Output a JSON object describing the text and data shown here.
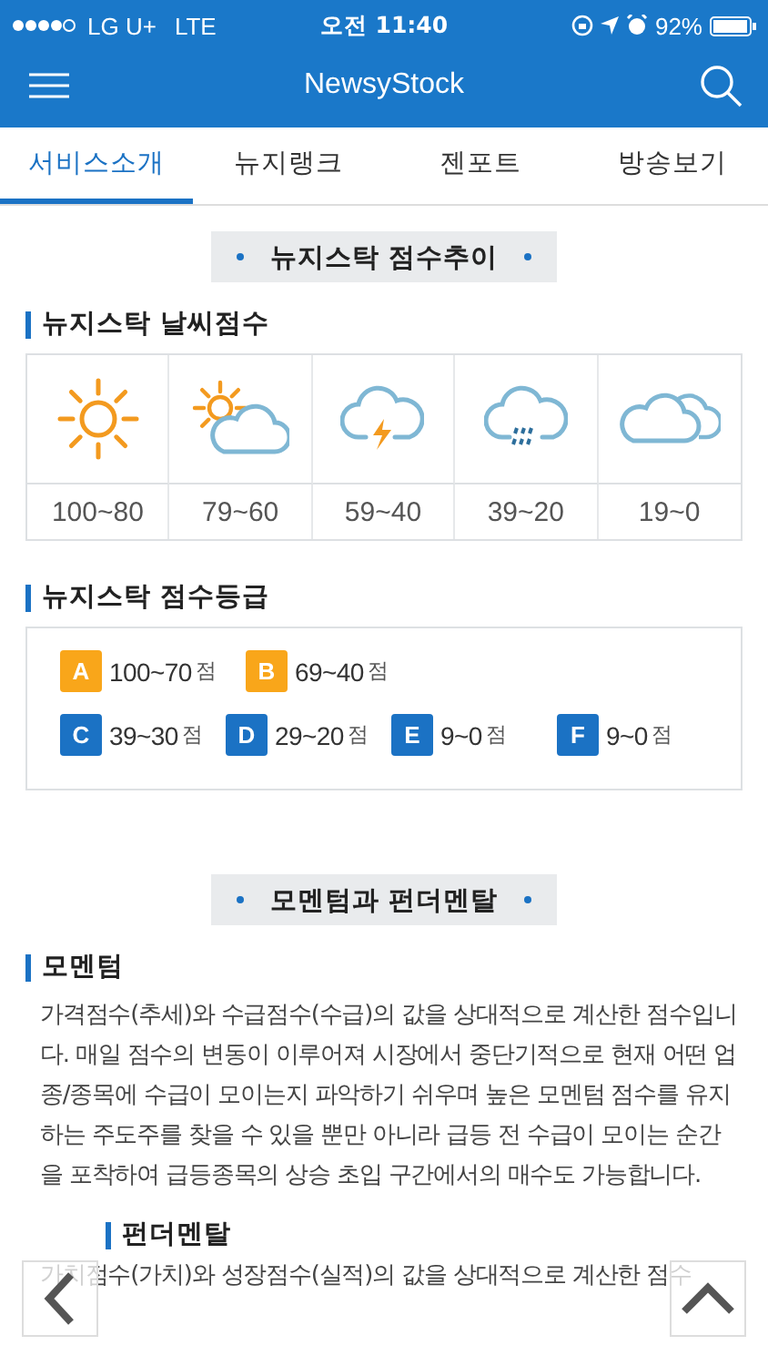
{
  "status_bar": {
    "carrier": "LG U+",
    "network": "LTE",
    "time": "오전 11:40",
    "battery": "92%"
  },
  "app_bar": {
    "title": "NewsyStock"
  },
  "tabs": [
    {
      "label": "서비스소개",
      "selected": true
    },
    {
      "label": "뉴지랭크",
      "selected": false
    },
    {
      "label": "젠포트",
      "selected": false
    },
    {
      "label": "방송보기",
      "selected": false
    }
  ],
  "sections": [
    {
      "title": "뉴지스탁 점수추이",
      "blocks": [
        {
          "kind": "weather",
          "heading": "뉴지스탁 날씨점수",
          "items": [
            {
              "kind": "sun",
              "range": "100~80"
            },
            {
              "kind": "partly",
              "range": "79~60"
            },
            {
              "kind": "thunder",
              "range": "59~40"
            },
            {
              "kind": "rain",
              "range": "39~20"
            },
            {
              "kind": "cloudy",
              "range": "19~0"
            }
          ]
        },
        {
          "kind": "grades",
          "heading": "뉴지스탁 점수등급",
          "rows": [
            [
              {
                "letter": "A",
                "range": "100~70",
                "unit": "점",
                "color": "#f9a61a"
              },
              {
                "letter": "B",
                "range": "69~40",
                "unit": "점",
                "color": "#f9a61a"
              }
            ],
            [
              {
                "letter": "C",
                "range": "39~30",
                "unit": "점",
                "color": "#1b72c4"
              },
              {
                "letter": "D",
                "range": "29~20",
                "unit": "점",
                "color": "#1b72c4"
              },
              {
                "letter": "E",
                "range": "9~0",
                "unit": "점",
                "color": "#1b72c4"
              },
              {
                "letter": "F",
                "range": "9~0",
                "unit": "점",
                "color": "#1b72c4"
              }
            ]
          ]
        }
      ]
    },
    {
      "title": "모멘텀과 펀더멘탈",
      "blocks": [
        {
          "kind": "text",
          "heading": "모멘텀",
          "body": "가격점수(추세)와 수급점수(수급)의 값을 상대적으로 계산한 점수입니다. 매일 점수의 변동이 이루어져 시장에서 중단기적으로 현재 어떤 업종/종목에 수급이 모이는지 파악하기 쉬우며 높은 모멘텀 점수를 유지하는 주도주를 찾을 수 있을 뿐만 아니라 급등 전 수급이 모이는 순간을 포착하여 급등종목의 상승 초입 구간에서의 매수도 가능합니다."
        },
        {
          "kind": "text",
          "heading": "펀더멘탈",
          "body": "가치점수(가치)와 성장점수(실적)의 값을 상대적으로 계산한 점수"
        }
      ]
    }
  ]
}
